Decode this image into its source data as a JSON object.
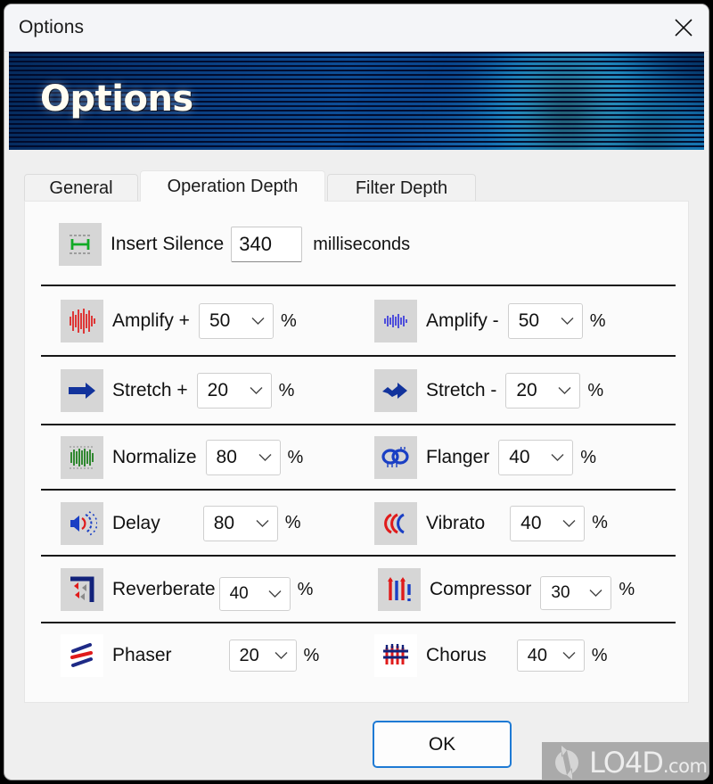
{
  "window": {
    "title": "Options",
    "close_icon": "close-icon"
  },
  "banner": {
    "heading": "Options"
  },
  "tabs": [
    {
      "id": "general",
      "label": "General",
      "active": false
    },
    {
      "id": "operation-depth",
      "label": "Operation Depth",
      "active": true
    },
    {
      "id": "filter-depth",
      "label": "Filter Depth",
      "active": false
    }
  ],
  "settings": {
    "insert_silence": {
      "icon": "insert-silence-icon",
      "label": "Insert Silence",
      "value": "340",
      "unit": "milliseconds"
    },
    "rows": [
      {
        "left": {
          "icon": "amplify-plus-icon",
          "label": "Amplify +",
          "value": "50",
          "unit": "%"
        },
        "right": {
          "icon": "amplify-minus-icon",
          "label": "Amplify -",
          "value": "50",
          "unit": "%"
        }
      },
      {
        "left": {
          "icon": "stretch-plus-icon",
          "label": "Stretch +",
          "value": "20",
          "unit": "%"
        },
        "right": {
          "icon": "stretch-minus-icon",
          "label": "Stretch -",
          "value": "20",
          "unit": "%"
        }
      },
      {
        "left": {
          "icon": "normalize-icon",
          "label": "Normalize",
          "value": "80",
          "unit": "%"
        },
        "right": {
          "icon": "flanger-icon",
          "label": "Flanger",
          "value": "40",
          "unit": "%"
        }
      },
      {
        "left": {
          "icon": "delay-icon",
          "label": "Delay",
          "value": "80",
          "unit": "%"
        },
        "right": {
          "icon": "vibrato-icon",
          "label": "Vibrato",
          "value": "40",
          "unit": "%"
        }
      },
      {
        "left": {
          "icon": "reverberate-icon",
          "label": "Reverberate",
          "value": "40",
          "unit": "%"
        },
        "right": {
          "icon": "compressor-icon",
          "label": "Compressor",
          "value": "30",
          "unit": "%"
        }
      },
      {
        "left": {
          "icon": "phaser-icon",
          "label": "Phaser",
          "value": "20",
          "unit": "%"
        },
        "right": {
          "icon": "chorus-icon",
          "label": "Chorus",
          "value": "40",
          "unit": "%"
        }
      }
    ]
  },
  "footer": {
    "ok_label": "OK"
  },
  "watermark": {
    "text": "LO4D",
    "suffix": ".com"
  },
  "colors": {
    "accent": "#1e7ad4",
    "banner_dark": "#062a5c",
    "banner_light": "#36b8f0",
    "separator": "#161616"
  }
}
